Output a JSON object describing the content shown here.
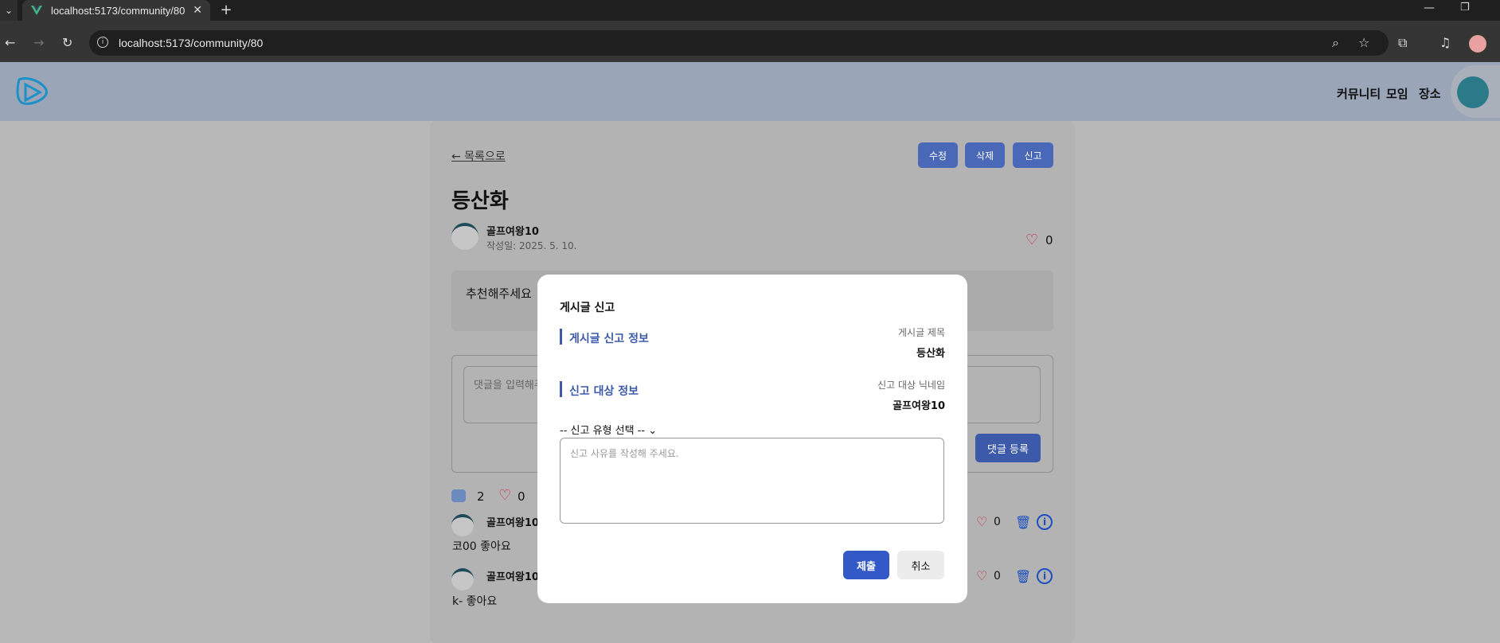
{
  "browser": {
    "tab_title": "localhost:5173/community/80",
    "url": "localhost:5173/community/80"
  },
  "site": {
    "nav": [
      "커뮤니티",
      "모임",
      "장소"
    ]
  },
  "post": {
    "back_label": "← 목록으로",
    "actions": {
      "edit": "수정",
      "delete": "삭제",
      "report": "신고"
    },
    "title": "등산화",
    "author": "골프여왕10",
    "date": "작성일: 2025. 5. 10.",
    "likes": "0",
    "content": "추천해주세요"
  },
  "comment_form": {
    "placeholder": "댓글을 입력해주",
    "submit": "댓글 등록"
  },
  "stats": {
    "comments": "2",
    "likes": "0"
  },
  "replies": [
    {
      "author": "골프여왕10",
      "text": "코00 좋아요",
      "likes": "0"
    },
    {
      "author": "골프여왕10",
      "text": "k- 좋아요",
      "likes": "0"
    }
  ],
  "modal": {
    "title": "게시글 신고",
    "section_post": "게시글 신고 정보",
    "label_post_title": "게시글 제목",
    "value_post_title": "등산화",
    "section_target": "신고 대상 정보",
    "label_target_nick": "신고 대상 닉네임",
    "value_target_nick": "골프여왕10",
    "select_placeholder": "-- 신고 유형 선택 --",
    "reason_placeholder": "신고 사유를 작성해 주세요.",
    "submit": "제출",
    "cancel": "취소"
  }
}
